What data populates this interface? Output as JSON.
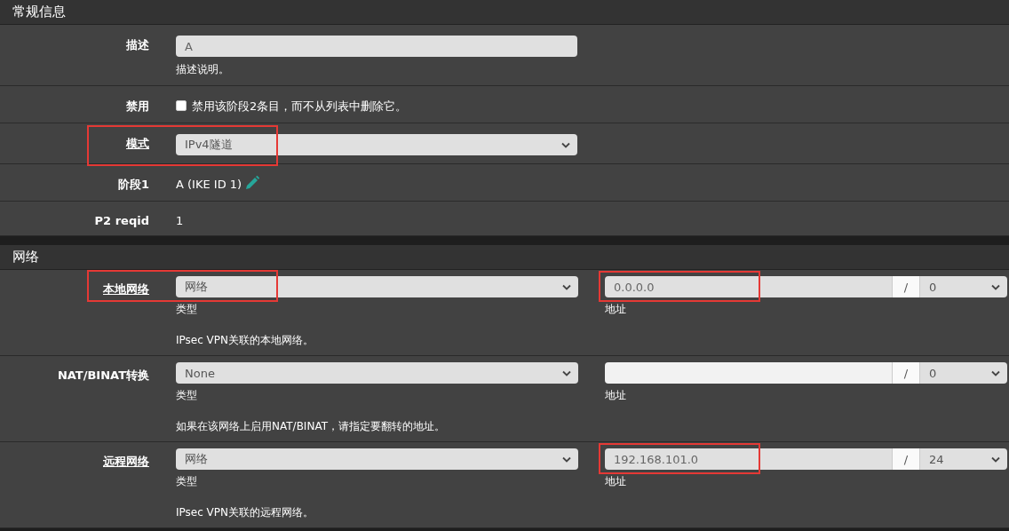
{
  "sections": [
    {
      "title": "常规信息",
      "rows": [
        {
          "kind": "text-input",
          "label": "描述",
          "label_link": false,
          "highlighted": false,
          "value": "A",
          "help": "描述说明。"
        },
        {
          "kind": "checkbox",
          "label": "禁用",
          "label_link": false,
          "highlighted": false,
          "checked": false,
          "text": "禁用该阶段2条目，而不从列表中删除它。"
        },
        {
          "kind": "select",
          "label": "模式",
          "label_link": true,
          "highlighted": true,
          "value": "IPv4隧道"
        },
        {
          "kind": "edit-link",
          "label": "阶段1",
          "label_link": false,
          "highlighted": false,
          "text": "A (IKE ID 1)"
        },
        {
          "kind": "plain",
          "label": "P2 reqid",
          "label_link": false,
          "highlighted": false,
          "text": "1"
        }
      ]
    },
    {
      "title": "网络",
      "rows": [
        {
          "kind": "network",
          "label": "本地网络",
          "label_link": true,
          "highlighted": true,
          "type": {
            "value": "网络",
            "caption": "类型"
          },
          "address": {
            "value": "0.0.0.0",
            "disabled": true,
            "highlighted": true,
            "separator": "/",
            "mask": "0",
            "caption": "地址"
          },
          "help": "IPsec VPN关联的本地网络。"
        },
        {
          "kind": "network",
          "label": "NAT/BINAT转换",
          "label_link": false,
          "highlighted": false,
          "type": {
            "value": "None",
            "caption": "类型"
          },
          "address": {
            "disabled": false,
            "highlighted": false,
            "separator": "/",
            "mask": "0",
            "caption": "地址"
          },
          "help": "如果在该网络上启用NAT/BINAT，请指定要翻转的地址。"
        },
        {
          "kind": "network",
          "label": "远程网络",
          "label_link": true,
          "highlighted": false,
          "type": {
            "value": "网络",
            "caption": "类型"
          },
          "address": {
            "value": "192.168.101.0",
            "disabled": true,
            "highlighted": true,
            "separator": "/",
            "mask": "24",
            "caption": "地址"
          },
          "help": "IPsec VPN关联的远程网络。"
        }
      ]
    }
  ]
}
